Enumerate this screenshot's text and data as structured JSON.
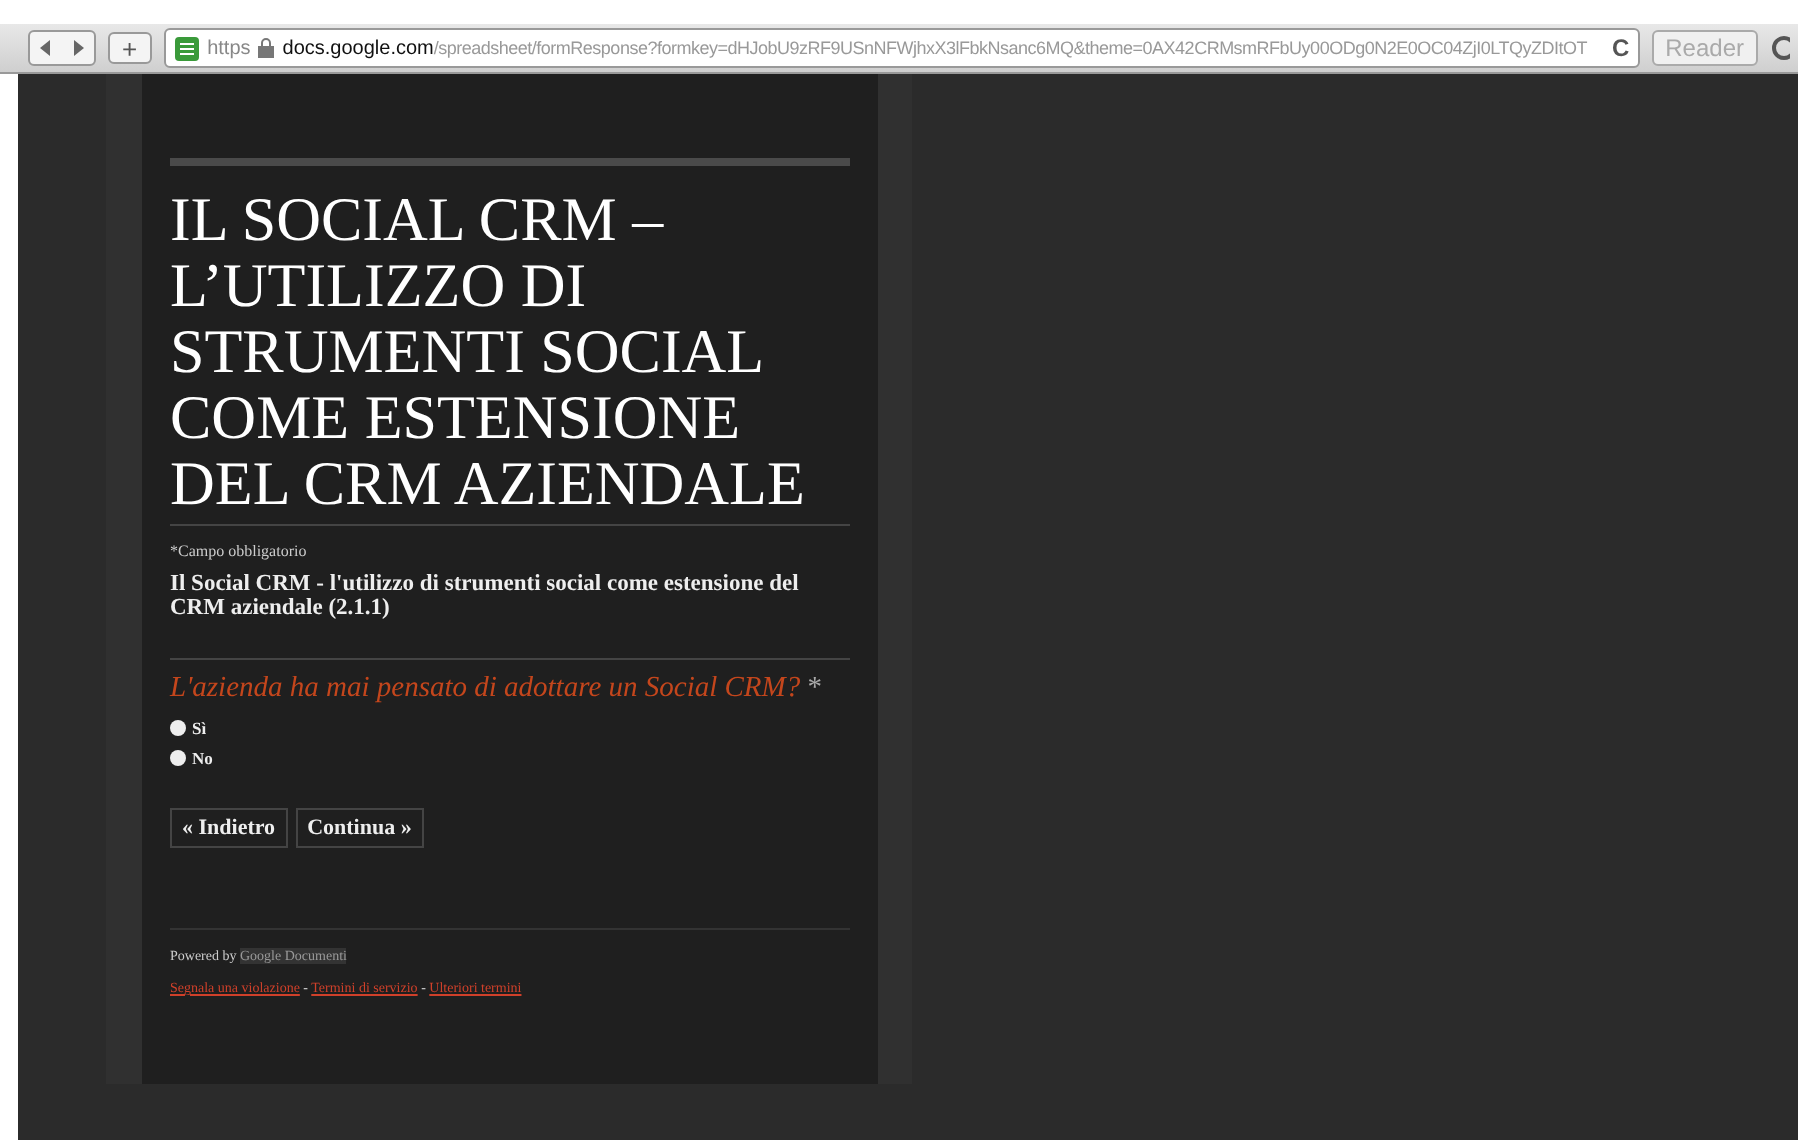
{
  "toolbar": {
    "add_button": "+",
    "scheme": "https",
    "host": "docs.google.com",
    "path": "/spreadsheet/formResponse?formkey=dHJobU9zRF9USnNFWjhxX3lFbkNsanc6MQ&theme=0AX42CRMsmRFbUy00ODg0N2E0OC04ZjI0LTQyZDItOT",
    "reload": "C",
    "reader": "Reader"
  },
  "form": {
    "title": "IL SOCIAL CRM – L’UTILIZZO DI STRUMENTI SOCIAL COME ESTENSIONE DEL CRM AZIENDALE",
    "required_note": "*Campo obbligatorio",
    "section_title": "Il Social CRM - l'utilizzo di strumenti social come estensione del CRM aziendale (2.1.1)",
    "question": {
      "text": "L'azienda ha mai pensato di adottare un Social CRM?",
      "required_mark": "*",
      "options": [
        {
          "label": "Sì",
          "selected": false
        },
        {
          "label": "No",
          "selected": false
        }
      ]
    },
    "buttons": [
      {
        "label": "« Indietro"
      },
      {
        "label": "Continua »"
      }
    ],
    "footer": {
      "powered_by": "Powered by",
      "powered_link": "Google Documenti",
      "links": [
        {
          "label": "Segnala una violazione"
        },
        {
          "label": "Termini di servizio"
        },
        {
          "label": "Ulteriori termini"
        }
      ],
      "separator": "-"
    }
  }
}
